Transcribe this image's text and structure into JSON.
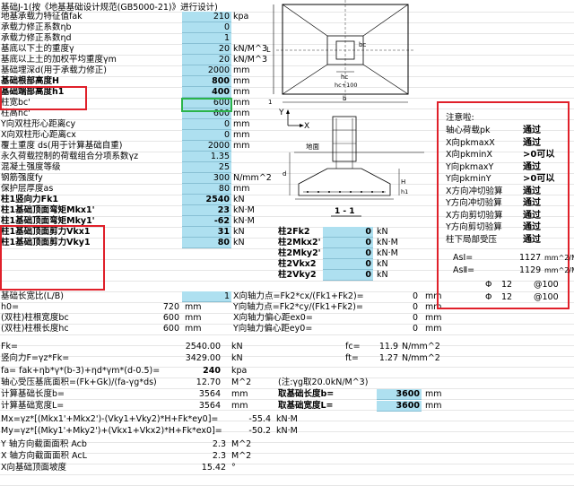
{
  "header": "基础J-1(按《地基基础设计规范(GB5000-21)》进行设计)",
  "rows_top": [
    {
      "label": "地基承载力特征值fak",
      "value": "210",
      "unit": "kpa"
    },
    {
      "label": "承载力修正系数ηb",
      "value": "0",
      "unit": ""
    },
    {
      "label": "承载力修正系数ηd",
      "value": "1",
      "unit": ""
    },
    {
      "label": "基底以下土的重度γ",
      "value": "20",
      "unit": "kN/M^3"
    },
    {
      "label": "基底以上土的加权平均重度γm",
      "value": "20",
      "unit": "kN/M^3"
    },
    {
      "label": "基础埋深d(用于承载力修正)",
      "value": "2000",
      "unit": "mm"
    },
    {
      "label": "基础根部高度H",
      "value": "800",
      "unit": "mm"
    },
    {
      "label": "基础端部高度h1",
      "value": "400",
      "unit": "mm"
    },
    {
      "label": "柱宽bc'",
      "value": "600",
      "unit": "mm"
    },
    {
      "label": "柱高hc'",
      "value": "600",
      "unit": "mm"
    },
    {
      "label": "Y向双柱形心距离cy",
      "value": "0",
      "unit": "mm"
    },
    {
      "label": "X向双柱形心距离cx",
      "value": "0",
      "unit": "mm"
    },
    {
      "label": "覆土重度 ds(用于计算基础自重)",
      "value": "2000",
      "unit": "mm"
    },
    {
      "label": "永久荷载控制的荷载组合分项系数γz",
      "value": "1.35",
      "unit": ""
    },
    {
      "label": "混凝土强度等级",
      "value": "25",
      "unit": ""
    },
    {
      "label": "钢筋强度fy",
      "value": "300",
      "unit": "N/mm^2"
    },
    {
      "label": "保护层厚度as",
      "value": "80",
      "unit": "mm"
    },
    {
      "label": "柱1竖向力Fk1",
      "value": "2540",
      "unit": "kN"
    },
    {
      "label": "柱1基础顶面弯矩Mkx1'",
      "value": "23",
      "unit": "kN·M"
    },
    {
      "label": "柱1基础顶面弯矩Mky1'",
      "value": "-62",
      "unit": "kN·M"
    },
    {
      "label": "柱1基础顶面剪力Vkx1",
      "value": "31",
      "unit": "kN"
    },
    {
      "label": "柱1基础顶面剪力Vky1",
      "value": "80",
      "unit": "kN"
    }
  ],
  "col2_rows": [
    {
      "label": "柱2Fk2",
      "value": "0",
      "unit": "kN"
    },
    {
      "label": "柱2Mkx2'",
      "value": "0",
      "unit": "kN·M"
    },
    {
      "label": "柱2Mky2'",
      "value": "0",
      "unit": "kN·M"
    },
    {
      "label": "柱2Vkx2",
      "value": "0",
      "unit": "kN"
    },
    {
      "label": "柱2Vky2",
      "value": "0",
      "unit": "kN"
    }
  ],
  "ratio_row": {
    "label": "基础长宽比(L/B)",
    "value": "1",
    "text": "X向轴力点=Fk2*cx/(Fk1+Fk2)=",
    "num": "0",
    "unit": "mm"
  },
  "h0_row": {
    "label": "h0=",
    "value": "720",
    "unit": "mm",
    "text": "Y向轴力点=Fk2*cy/(Fk1+Fk2)=",
    "num": "0",
    "unit2": "mm"
  },
  "bc_row": {
    "label": "(双柱)柱根宽度bc",
    "value": "600",
    "unit": "mm",
    "text": "X向轴力偏心距ex0=",
    "num": "0",
    "unit2": "mm"
  },
  "hc_row": {
    "label": "(双柱)柱根长度hc",
    "value": "600",
    "unit": "mm",
    "text": "Y向轴力偏心距ey0=",
    "num": "0",
    "unit2": "mm"
  },
  "fk_row": {
    "label": "Fk=",
    "value": "2540.00",
    "unit": "kN",
    "fc_label": "fc=",
    "fc_value": "11.9",
    "fc_unit": "N/mm^2"
  },
  "f_row": {
    "label": "竖向力F=γz*Fk=",
    "value": "3429.00",
    "unit": "kN",
    "ft_label": "ft=",
    "ft_value": "1.27",
    "ft_unit": "N/mm^2"
  },
  "fa_row": {
    "label": "fa= fak+ηb*γ*(b-3)+ηd*γm*(d-0.5)=",
    "value": "240",
    "unit": "kpa"
  },
  "area_row": {
    "label": "轴心受压基底面积=(Fk+Gk)/(fa-γg*ds)",
    "value": "12.70",
    "unit": "M^2",
    "note": "(注:γg取20.0kN/M^3)"
  },
  "blen_row": {
    "label": "计算基础长度b=",
    "value": "3564",
    "unit": "mm",
    "take_label": "取基础长度b=",
    "take_value": "3600",
    "take_unit": "mm"
  },
  "bwid_row": {
    "label": "计算基础宽度L=",
    "value": "3564",
    "unit": "mm",
    "take_label": "取基础宽度L=",
    "take_value": "3600",
    "take_unit": "mm"
  },
  "mx_row": {
    "label": "Mx=γz*[(Mkx1'+Mkx2')-(Vky1+Vky2)*H+Fk*ey0]=",
    "value": "-55.4",
    "unit": "kN·M"
  },
  "my_row": {
    "label": "My=γz*[(Mky1'+Mky2')+(Vkx1+Vkx2)*H+Fk*ex0]=",
    "value": "-50.2",
    "unit": "kN·M"
  },
  "acb_row": {
    "label": "Y 轴方向截面面积 Acb",
    "value": "2.3",
    "unit": "M^2"
  },
  "acl_row": {
    "label": "X 轴方向截面面积 AcL",
    "value": "2.3",
    "unit": "M^2"
  },
  "slope_row": {
    "label": "X向基础顶面坡度",
    "value": "15.42",
    "unit": "°"
  },
  "notice": {
    "title": "注意啦:",
    "items": [
      {
        "label": "轴心荷载pk",
        "value": "通过"
      },
      {
        "label": "X向pkmaxX",
        "value": "通过"
      },
      {
        "label": "X向pkminX",
        "value": ">0可以"
      },
      {
        "label": "Y向pkmaxY",
        "value": "通过"
      },
      {
        "label": "Y向pkminY",
        "value": ">0可以"
      },
      {
        "label": "X方向冲切验算",
        "value": "通过"
      },
      {
        "label": "Y方向冲切验算",
        "value": "通过"
      },
      {
        "label": "X方向剪切验算",
        "value": "通过"
      },
      {
        "label": "Y方向剪切验算",
        "value": "通过"
      },
      {
        "label": "柱下局部受压",
        "value": "通过"
      }
    ],
    "as1_label": "AsⅠ=",
    "as1_value": "1127",
    "as1_unit": "mm^2/M",
    "as2_label": "AsⅡ=",
    "as2_value": "1129",
    "as2_unit": "mm^2/M",
    "bar1_sym": "Φ",
    "bar1_d": "12",
    "bar1_s": "@100",
    "bar2_sym": "Φ",
    "bar2_d": "12",
    "bar2_s": "@100"
  },
  "diagram": {
    "labels": {
      "L": "L",
      "b": "b",
      "bc": "bc",
      "hc": "hc",
      "hc100": "hc+100",
      "Y": "Y",
      "X": "X",
      "ground": "地面",
      "d": "d",
      "H": "H",
      "h1": "h1",
      "section": "1 - 1",
      "one": "1"
    }
  }
}
